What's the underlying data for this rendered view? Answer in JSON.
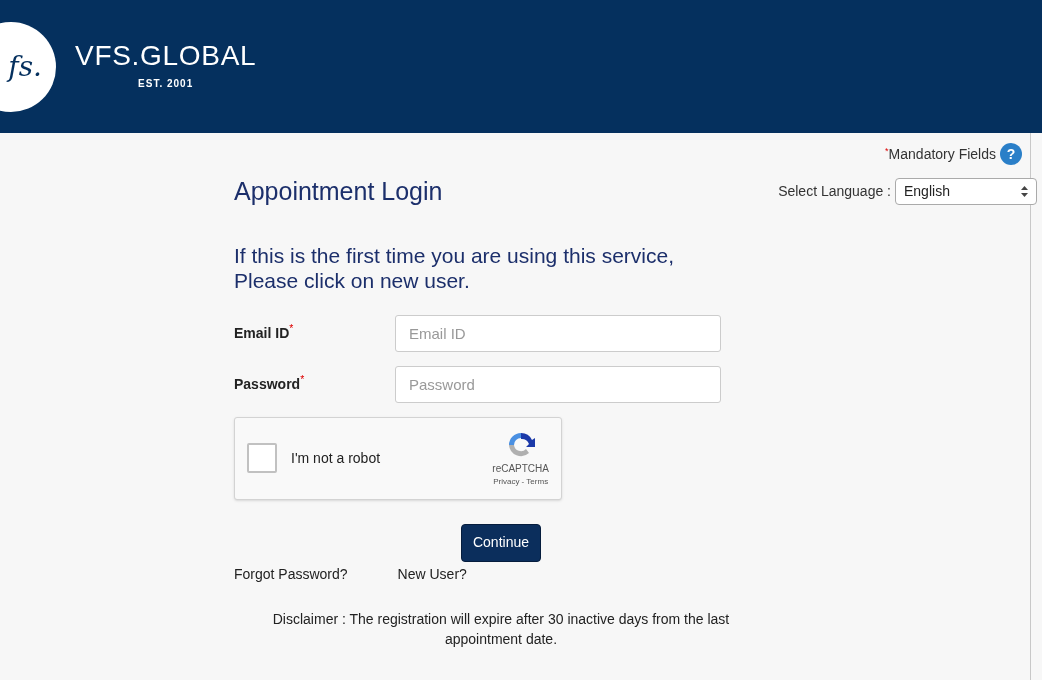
{
  "header": {
    "logo_mark": "fs.",
    "brand": "VFS.GLOBAL",
    "established": "EST. 2001"
  },
  "mandatory_note": {
    "marker": "*",
    "text": "Mandatory Fields",
    "help": "?"
  },
  "title": "Appointment Login",
  "language": {
    "label": "Select Language :",
    "value": "English"
  },
  "intro": "If this is the first time you are using this service, Please click on new user.",
  "fields": [
    {
      "label": "Email ID",
      "required": true,
      "placeholder": "Email ID"
    },
    {
      "label": "Password",
      "required": true,
      "placeholder": "Password"
    }
  ],
  "captcha": {
    "label": "I'm not a robot",
    "checked": false,
    "brand": "reCAPTCHA",
    "links": "Privacy - Terms"
  },
  "continue_button": "Continue",
  "links": [
    "Forgot Password?",
    "New User?"
  ],
  "disclaimer": "Disclaimer : The registration will expire after 30 inactive days from the last appointment date."
}
